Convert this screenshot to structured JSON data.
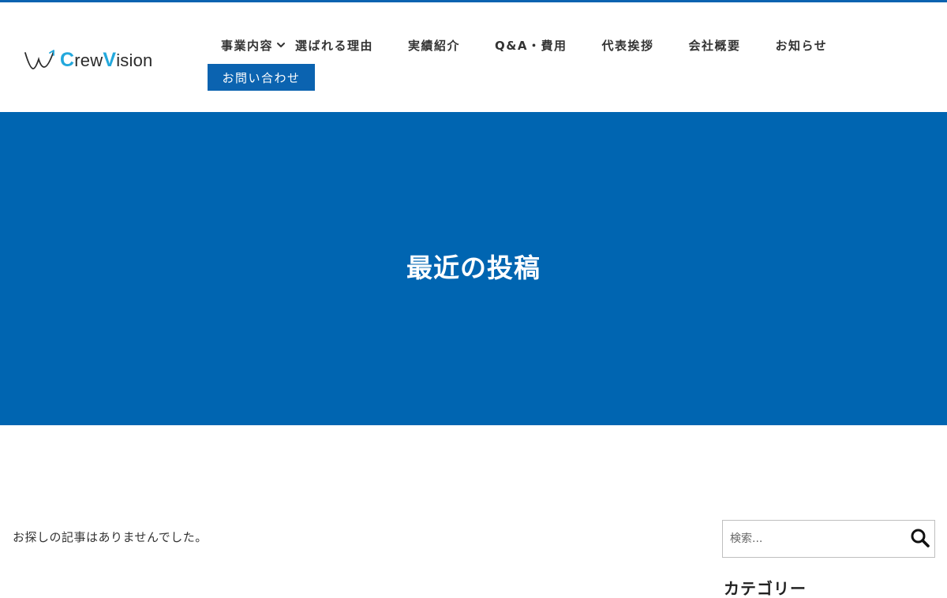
{
  "site": {
    "logo_prefix": "C",
    "logo_part1": "rew",
    "logo_accent2": "V",
    "logo_part2": "ision",
    "brand_color": "#0b63b0",
    "logo_accent_color": "#23a8dc"
  },
  "nav": {
    "items": [
      {
        "label": "事業内容",
        "has_dropdown": true,
        "icon": "chevron-down-icon"
      },
      {
        "label": "選ばれる理由"
      },
      {
        "label": "実績紹介"
      },
      {
        "label": "Q&A・費用"
      },
      {
        "label": "代表挨拶"
      },
      {
        "label": "会社概要"
      },
      {
        "label": "お知らせ"
      }
    ],
    "contact_label": "お問い合わせ"
  },
  "hero": {
    "title": "最近の投稿",
    "background": "#0065b1"
  },
  "main": {
    "message": "お探しの記事はありませんでした。"
  },
  "sidebar": {
    "search_placeholder": "検索...",
    "search_icon": "search-icon",
    "category_heading": "カテゴリー"
  }
}
